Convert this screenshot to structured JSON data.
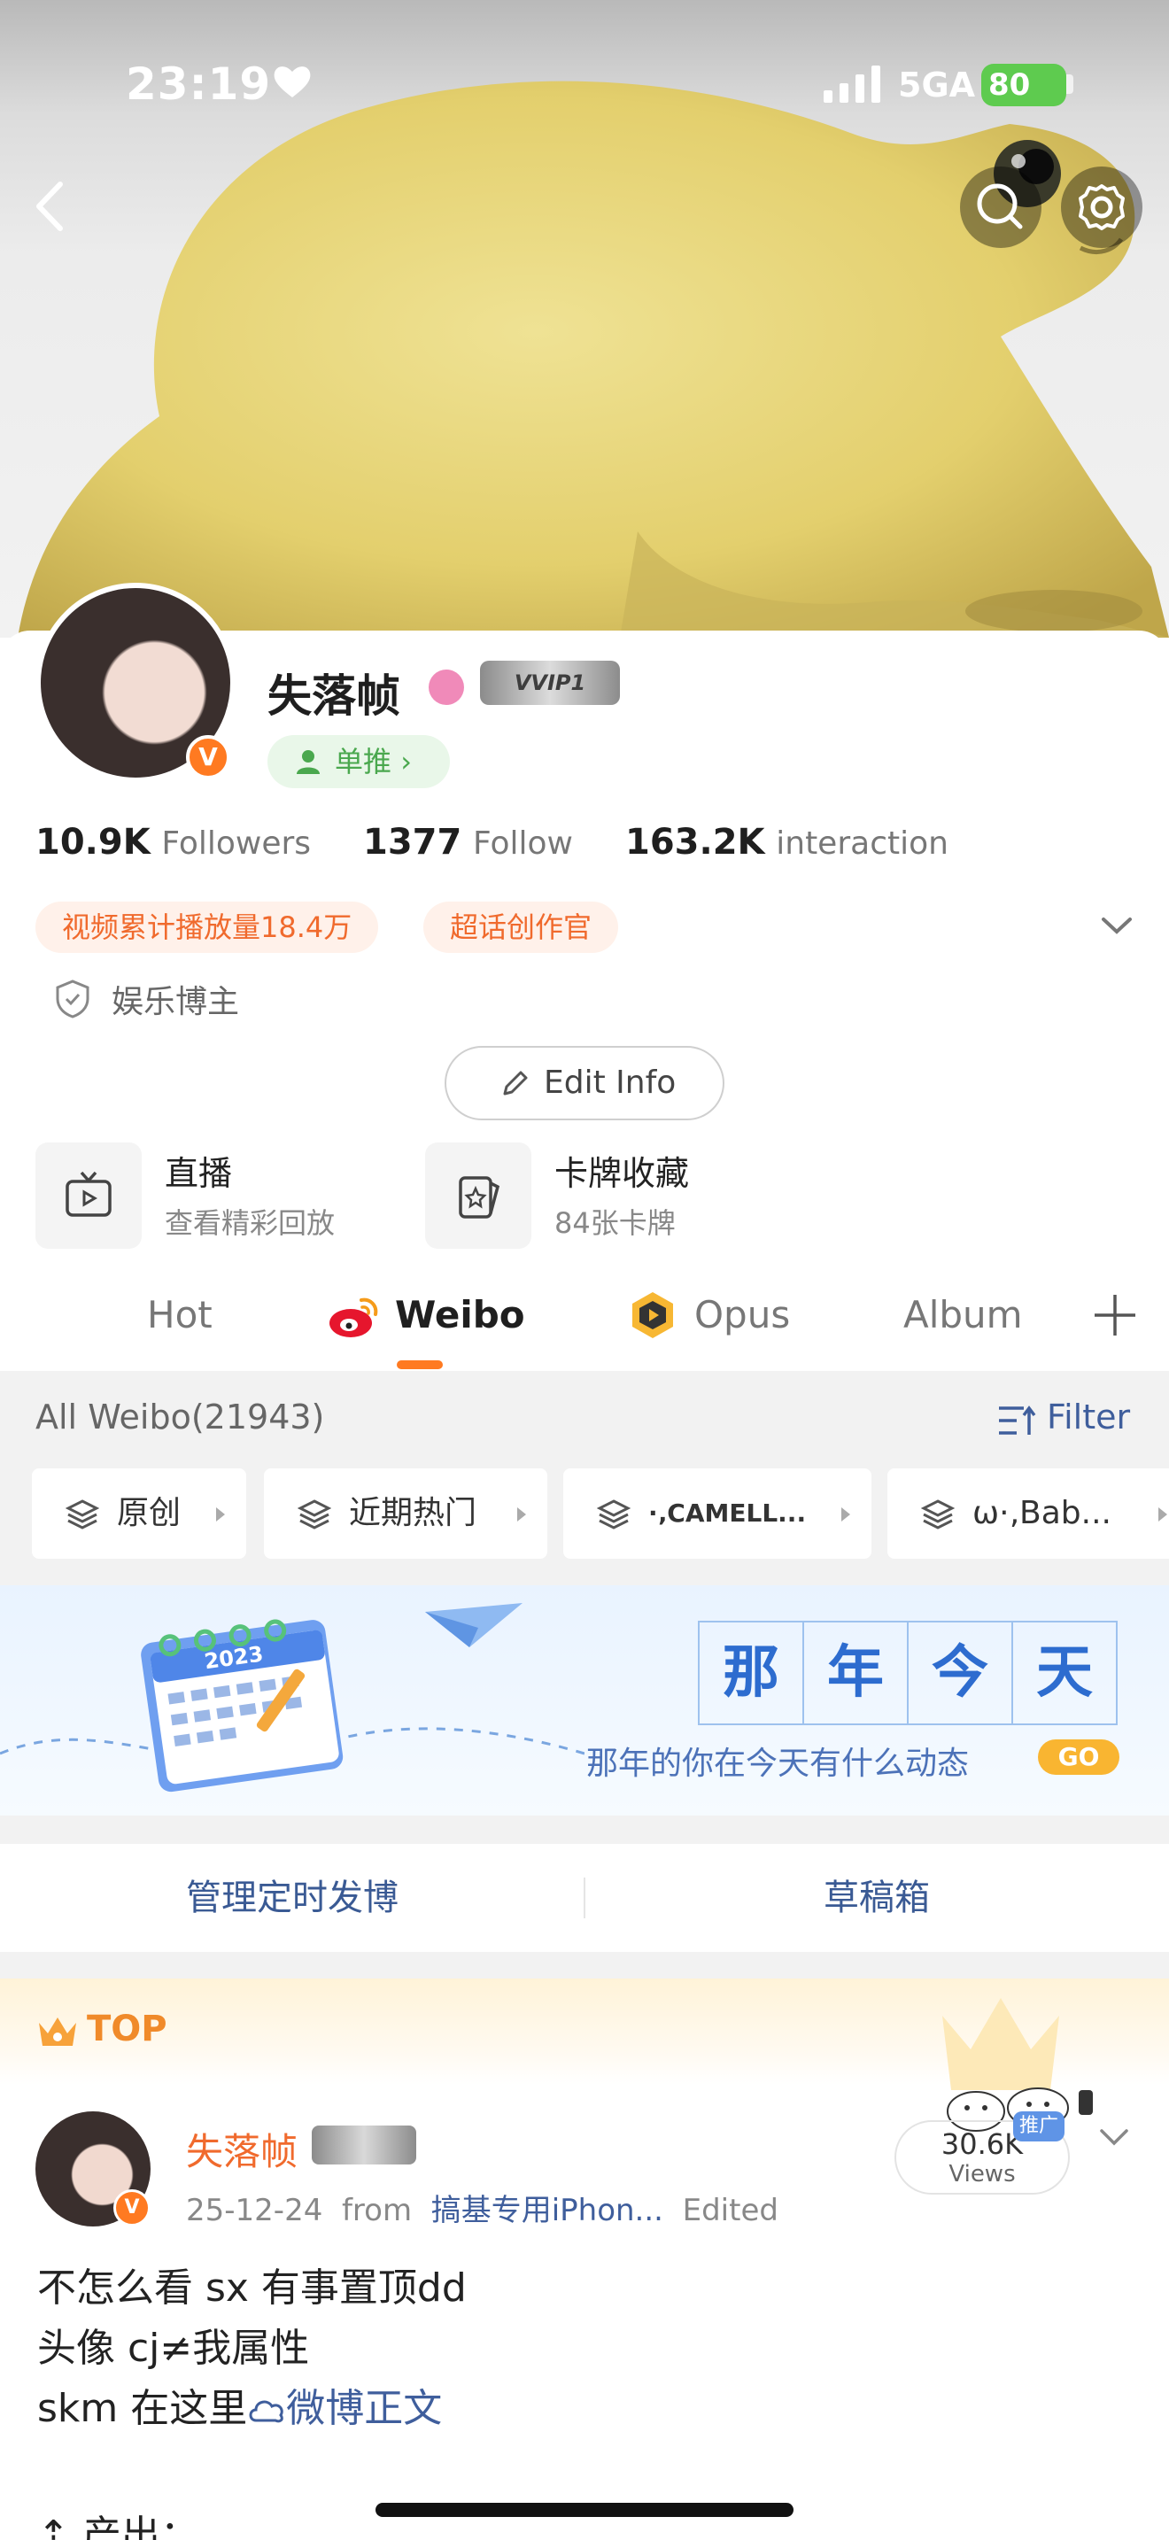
{
  "status_bar": {
    "time": "23:19",
    "network": "5GA",
    "battery": "80"
  },
  "profile": {
    "name": "失落帧",
    "vvip": "VVIP1",
    "tag": "单推",
    "stats": [
      {
        "value": "10.9K",
        "label": "Followers"
      },
      {
        "value": "1377",
        "label": "Follow"
      },
      {
        "value": "163.2K",
        "label": "interaction"
      }
    ],
    "honors": [
      "视频累计播放量18.4万",
      "超话创作官"
    ],
    "verify_label": "娱乐博主",
    "edit_label": "Edit Info",
    "features": [
      {
        "title": "直播",
        "subtitle": "查看精彩回放",
        "icon": "tv-icon"
      },
      {
        "title": "卡牌收藏",
        "subtitle": "84张卡牌",
        "icon": "card-icon"
      }
    ]
  },
  "tabs": [
    "Hot",
    "Weibo",
    "Opus",
    "Album"
  ],
  "feed": {
    "all_label": "All Weibo(21943)",
    "filter_label": "Filter",
    "chips": [
      "原创",
      "近期热门",
      "·‚CAMELL...",
      "ω·‚Bab..."
    ]
  },
  "banner": {
    "chars": [
      "那",
      "年",
      "今",
      "天"
    ],
    "subtitle": "那年的你在今天有什么动态",
    "go": "GO",
    "calendar_year": "2023"
  },
  "manage": {
    "left": "管理定时发博",
    "right": "草稿箱"
  },
  "post": {
    "top_label": "TOP",
    "author": "失落帧",
    "date": "25-12-24",
    "from_label": "from",
    "source": "搞基专用iPhon...",
    "edited": "Edited",
    "views_count": "30.6K",
    "views_label": "Views",
    "ad_tag": "推广",
    "lines": [
      "不怎么看 sx 有事置顶dd",
      "头像 cj≠我属性",
      "skm 在这里"
    ],
    "link": "微博正文",
    "next_line": "产出："
  },
  "colors": {
    "accent": "#ff7a21",
    "link": "#3f5e9c",
    "green": "#4aa84e"
  }
}
